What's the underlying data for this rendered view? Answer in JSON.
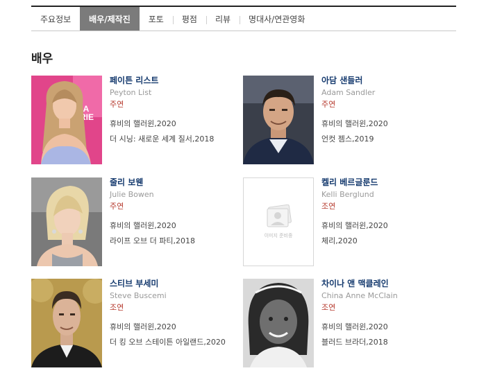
{
  "tabs": [
    {
      "label": "주요정보",
      "active": false
    },
    {
      "label": "배우/제작진",
      "active": true
    },
    {
      "label": "포토",
      "active": false
    },
    {
      "label": "평점",
      "active": false
    },
    {
      "label": "리뷰",
      "active": false
    },
    {
      "label": "명대사/연관영화",
      "active": false
    }
  ],
  "section_title": "배우",
  "cast": [
    {
      "name_kr": "페이튼 리스트",
      "name_en": "Peyton List",
      "role": "주연",
      "films": [
        "휴비의 핼러윈,2020",
        "더 시닝: 새로운 세계 질서,2018"
      ],
      "photo": "actor-photo"
    },
    {
      "name_kr": "아담 샌들러",
      "name_en": "Adam Sandler",
      "role": "주연",
      "films": [
        "휴비의 핼러윈,2020",
        "언컷 젬스,2019"
      ],
      "photo": "actor-photo"
    },
    {
      "name_kr": "줄리 보웬",
      "name_en": "Julie Bowen",
      "role": "주연",
      "films": [
        "휴비의 핼러윈,2020",
        "라이프 오브 더 파티,2018"
      ],
      "photo": "actor-photo"
    },
    {
      "name_kr": "켈리 베르글룬드",
      "name_en": "Kelli Berglund",
      "role": "조연",
      "films": [
        "휴비의 핼러윈,2020",
        "체리,2020"
      ],
      "photo": "placeholder-icon",
      "placeholder_text": "이미지 준비중"
    },
    {
      "name_kr": "스티브 부세미",
      "name_en": "Steve Buscemi",
      "role": "조연",
      "films": [
        "휴비의 핼러윈,2020",
        "더 킹 오브 스테이튼 아일랜드,2020"
      ],
      "photo": "actor-photo"
    },
    {
      "name_kr": "차이나 앤 맥클레인",
      "name_en": "China Anne McClain",
      "role": "조연",
      "films": [
        "휴비의 핼러윈,2020",
        "블러드 브라더,2018"
      ],
      "photo": "actor-photo"
    }
  ],
  "colors": {
    "name": "#153a6e",
    "role": "#b63a2e",
    "active_tab": "#7b7b7b"
  }
}
